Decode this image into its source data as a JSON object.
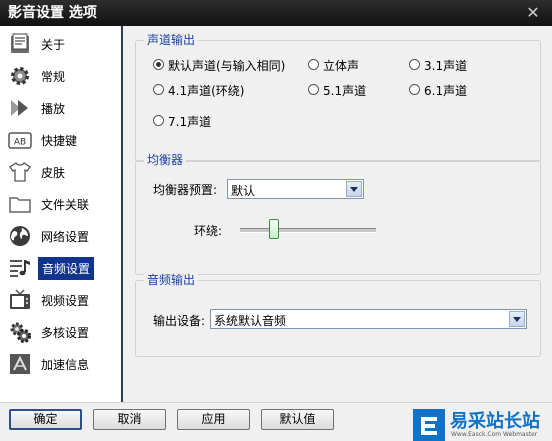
{
  "window": {
    "title": "影音设置 选项",
    "close_glyph": "✕"
  },
  "sidebar": {
    "items": [
      {
        "label": "关于",
        "icon": "book-icon"
      },
      {
        "label": "常规",
        "icon": "gear-icon"
      },
      {
        "label": "播放",
        "icon": "play-arrows-icon"
      },
      {
        "label": "快捷键",
        "icon": "keyboard-ab-icon",
        "icon_text": "AB"
      },
      {
        "label": "皮肤",
        "icon": "shirt-icon"
      },
      {
        "label": "文件关联",
        "icon": "folder-icon"
      },
      {
        "label": "网络设置",
        "icon": "globe-icon"
      },
      {
        "label": "音频设置",
        "icon": "audio-icon",
        "selected": true
      },
      {
        "label": "视频设置",
        "icon": "tv-icon"
      },
      {
        "label": "多核设置",
        "icon": "multicore-gear-icon"
      },
      {
        "label": "加速信息",
        "icon": "speed-icon"
      }
    ]
  },
  "channel_output": {
    "title": "声道输出",
    "options": [
      {
        "label": "默认声道(与输入相同)",
        "selected": true
      },
      {
        "label": "立体声",
        "selected": false
      },
      {
        "label": "3.1声道",
        "selected": false
      },
      {
        "label": "4.1声道(环绕)",
        "selected": false
      },
      {
        "label": "5.1声道",
        "selected": false
      },
      {
        "label": "6.1声道",
        "selected": false
      },
      {
        "label": "7.1声道",
        "selected": false
      }
    ]
  },
  "equalizer": {
    "title": "均衡器",
    "preset_label": "均衡器预置:",
    "preset_value": "默认",
    "surround_label": "环绕:",
    "surround_level": 0.25
  },
  "audio_output": {
    "title": "音频输出",
    "device_label": "输出设备:",
    "device_value": "系统默认音频"
  },
  "buttons": {
    "ok": "确定",
    "cancel": "取消",
    "apply": "应用",
    "default": "默认值"
  },
  "watermark": {
    "text": "易采站长站",
    "sub": "Www.Easck.Com Webmaster"
  },
  "colors": {
    "selected_bg": "#11358f",
    "group_title": "#1a3fa0",
    "sidebar_border": "#2a3f56"
  }
}
